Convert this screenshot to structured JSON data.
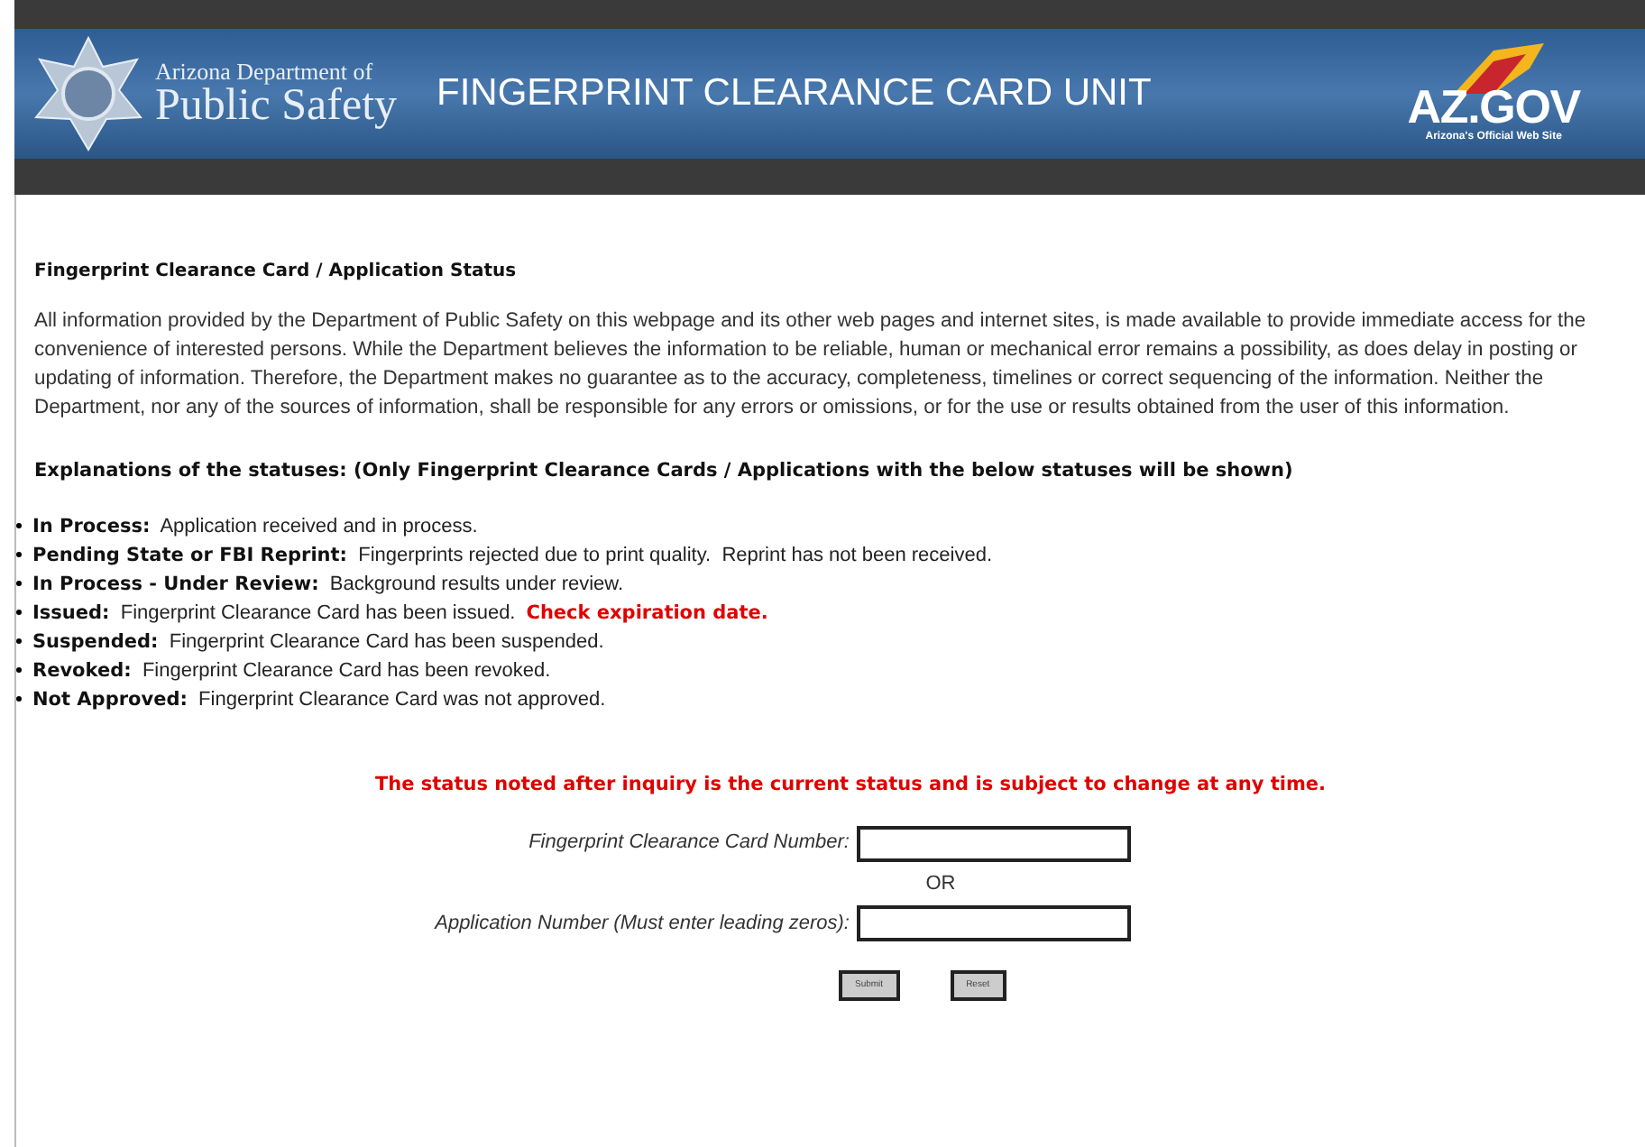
{
  "banner": {
    "agency_line1": "Arizona Department of",
    "agency_line2": "Public Safety",
    "title": "FINGERPRINT CLEARANCE CARD UNIT",
    "portal_logo": "AZ.GOV",
    "portal_tagline": "Arizona's Official Web Site"
  },
  "heading": "Fingerprint Clearance Card / Application Status",
  "disclaimer": "All information provided by the Department of Public Safety on this webpage and its other web pages and internet sites, is made available to provide immediate access for the convenience of interested persons. While the Department believes the information to be reliable, human or mechanical error remains a possibility, as does delay in posting or updating of information. Therefore, the Department makes no guarantee as to the accuracy, completeness, timelines or correct sequencing of the information. Neither the Department, nor any of the sources of information, shall be responsible for any errors or omissions, or for the use or results obtained from the user of this information.",
  "statuses_heading": "Explanations of the statuses: (Only Fingerprint Clearance Cards / Applications with the below statuses will be shown)",
  "statuses": [
    {
      "label": "In Process:",
      "text": "Application received and in process."
    },
    {
      "label": "Pending State or FBI Reprint:",
      "text": "Fingerprints rejected due to print quality.  Reprint has not been received."
    },
    {
      "label": "In Process - Under Review:",
      "text": "Background results under review."
    },
    {
      "label": "Issued:",
      "text": "Fingerprint Clearance Card has been issued.",
      "warning": "Check expiration date."
    },
    {
      "label": "Suspended:",
      "text": "Fingerprint Clearance Card has been suspended."
    },
    {
      "label": "Revoked:",
      "text": "Fingerprint Clearance Card has been revoked."
    },
    {
      "label": "Not Approved:",
      "text": "Fingerprint Clearance Card was not approved."
    }
  ],
  "notice": "The status noted after inquiry is the current status and is subject to change at any time.",
  "form": {
    "card_label": "Fingerprint Clearance Card Number:",
    "separator": "OR",
    "application_label": "Application Number (Must enter leading zeros):",
    "buttons": [
      "Submit",
      "Reset"
    ]
  }
}
